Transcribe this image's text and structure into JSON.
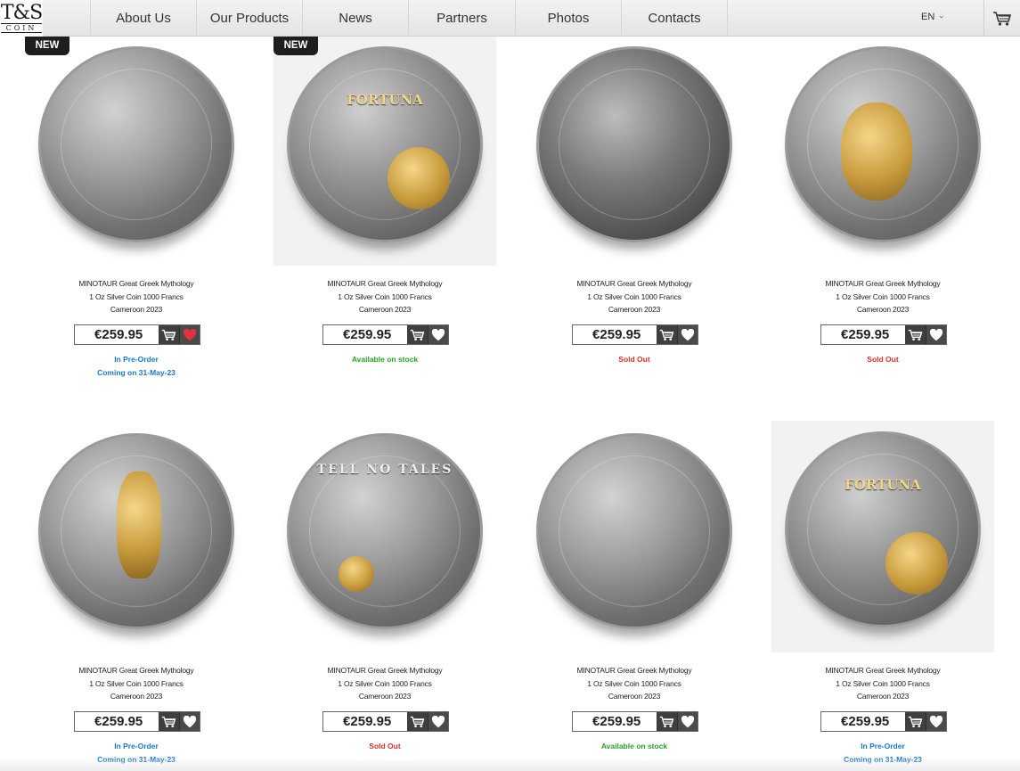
{
  "header": {
    "logo_main": "T&S",
    "logo_sub": "COIN",
    "nav": [
      "About Us",
      "Our Products",
      "News",
      "Partners",
      "Photos",
      "Contacts"
    ],
    "language": "EN"
  },
  "badges": {
    "new": "NEW"
  },
  "colors": {
    "pre_order": "#1976c8",
    "in_stock": "#2aa02a",
    "sold_out": "#d6312a",
    "wish_active": "#e0323c"
  },
  "products": [
    {
      "title_1": "MINOTAUR Great Greek Mythology",
      "title_2": "1 Oz Silver Coin 1000 Francs",
      "title_3": "Cameroon 2023",
      "price": "€259.95",
      "status_1": "In Pre-Order",
      "status_2": "Coming on 31-May-23",
      "badge": "NEW",
      "wishlisted": true
    },
    {
      "title_1": "MINOTAUR Great Greek Mythology",
      "title_2": "1 Oz Silver Coin 1000 Francs",
      "title_3": "Cameroon 2023",
      "price": "€259.95",
      "status_1": "Available on stock",
      "status_2": "",
      "badge": "NEW",
      "coin_text": "FORTUNA"
    },
    {
      "title_1": "MINOTAUR Great Greek Mythology",
      "title_2": "1 Oz Silver Coin 1000 Francs",
      "title_3": "Cameroon 2023",
      "price": "€259.95",
      "status_1": "Sold Out",
      "status_2": ""
    },
    {
      "title_1": "MINOTAUR Great Greek Mythology",
      "title_2": "1 Oz Silver Coin 1000 Francs",
      "title_3": "Cameroon 2023",
      "price": "€259.95",
      "status_1": "Sold Out",
      "status_2": ""
    },
    {
      "title_1": "MINOTAUR Great Greek Mythology",
      "title_2": "1 Oz Silver Coin 1000 Francs",
      "title_3": "Cameroon 2023",
      "price": "€259.95",
      "status_1": "In Pre-Order",
      "status_2": "Coming on 31-May-23"
    },
    {
      "title_1": "MINOTAUR Great Greek Mythology",
      "title_2": "1 Oz Silver Coin 1000 Francs",
      "title_3": "Cameroon 2023",
      "price": "€259.95",
      "status_1": "Sold Out",
      "status_2": "",
      "coin_text": "TELL NO TALES"
    },
    {
      "title_1": "MINOTAUR Great Greek Mythology",
      "title_2": "1 Oz Silver Coin 1000 Francs",
      "title_3": "Cameroon 2023",
      "price": "€259.95",
      "status_1": "Available on stock",
      "status_2": ""
    },
    {
      "title_1": "MINOTAUR Great Greek Mythology",
      "title_2": "1 Oz Silver Coin 1000 Francs",
      "title_3": "Cameroon 2023",
      "price": "€259.95",
      "status_1": "In Pre-Order",
      "status_2": "Coming on 31-May-23",
      "coin_text": "FORTUNA"
    }
  ]
}
